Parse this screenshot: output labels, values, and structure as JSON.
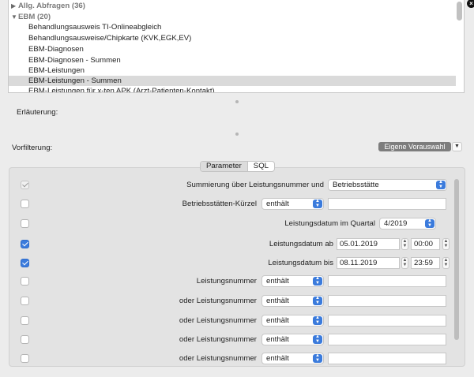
{
  "list": {
    "groups": [
      {
        "label": "Allg. Abfragen (36)",
        "expanded": false
      },
      {
        "label": "EBM (20)",
        "expanded": true
      }
    ],
    "items": [
      "Behandlungsausweis TI-Onlineabgleich",
      "Behandlungsausweise/Chipkarte (KVK,EGK,EV)",
      "EBM-Diagnosen",
      "EBM-Diagnosen - Summen",
      "EBM-Leistungen",
      "EBM-Leistungen - Summen",
      "EBM-Leistungen für x-ten APK (Arzt-Patienten-Kontakt)"
    ],
    "selected_item": "EBM-Leistungen - Summen"
  },
  "erlaeuterung_label": "Erläuterung:",
  "vorfilterung_label": "Vorfilterung:",
  "eigene_vorauswahl_button": "Eigene Vorauswahl",
  "tabs": {
    "parameter": "Parameter",
    "sql": "SQL",
    "active": "parameter"
  },
  "params": {
    "summierung": {
      "label": "Summierung über Leistungsnummer und",
      "value": "Betriebsstätte",
      "checked": true,
      "disabled": true
    },
    "kuerzel": {
      "label": "Betriebsstätten-Kürzel",
      "op": "enthält",
      "value": "",
      "checked": false
    },
    "quartal": {
      "label": "Leistungsdatum im Quartal",
      "value": "4/2019",
      "checked": false
    },
    "datum_ab": {
      "label": "Leistungsdatum ab",
      "date": "05.01.2019",
      "time": "00:00",
      "checked": true
    },
    "datum_bis": {
      "label": "Leistungsdatum bis",
      "date": "08.11.2019",
      "time": "23:59",
      "checked": true
    },
    "lnr": [
      {
        "label": "Leistungsnummer",
        "op": "enthält",
        "value": "",
        "checked": false
      },
      {
        "label": "oder Leistungsnummer",
        "op": "enthält",
        "value": "",
        "checked": false
      },
      {
        "label": "oder Leistungsnummer",
        "op": "enthält",
        "value": "",
        "checked": false
      },
      {
        "label": "oder Leistungsnummer",
        "op": "enthält",
        "value": "",
        "checked": false
      },
      {
        "label": "oder Leistungsnummer",
        "op": "enthält",
        "value": "",
        "checked": false
      }
    ]
  },
  "colors": {
    "accent": "#3b7bdc",
    "selection": "#dadada"
  }
}
